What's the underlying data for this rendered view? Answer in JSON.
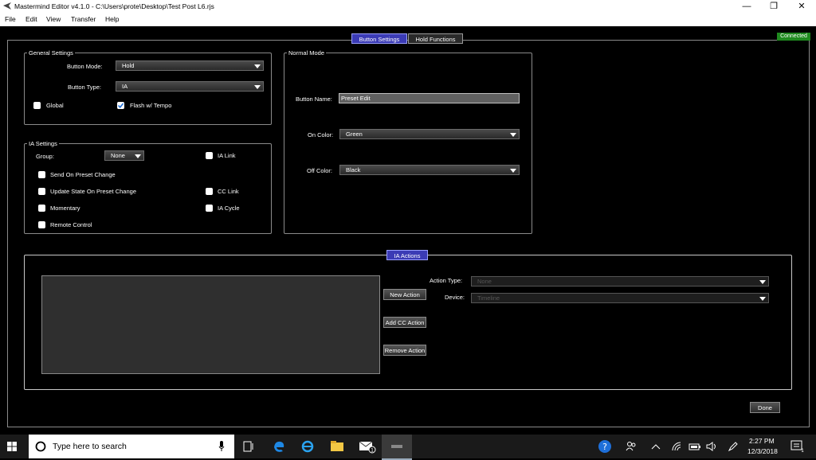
{
  "window": {
    "title": "Mastermind Editor v4.1.0 - C:\\Users\\prote\\Desktop\\Test Post L6.rjs",
    "minimize": "—",
    "maximize": "❐",
    "close": "✕"
  },
  "menu": [
    "File",
    "Edit",
    "View",
    "Transfer",
    "Help"
  ],
  "tabs": [
    "Button Settings",
    "Hold Functions"
  ],
  "status": {
    "connected": "Connected"
  },
  "general": {
    "title": "General Settings",
    "button_mode_label": "Button Mode:",
    "button_mode": "Hold",
    "button_type_label": "Button Type:",
    "button_type": "IA",
    "global_label": "Global",
    "global_checked": false,
    "flash_label": "Flash w/ Tempo",
    "flash_checked": true
  },
  "ia": {
    "title": "IA Settings",
    "group_label": "Group:",
    "group_value": "None",
    "ia_link": "IA Link",
    "send_on_preset": "Send On Preset Change",
    "update_state": "Update State On Preset Change",
    "cc_link": "CC Link",
    "momentary": "Momentary",
    "ia_cycle": "IA Cycle",
    "remote_control": "Remote Control"
  },
  "normal": {
    "title": "Normal Mode",
    "button_name_label": "Button Name:",
    "button_name": "Preset Edit",
    "on_color_label": "On Color:",
    "on_color": "Green",
    "off_color_label": "Off Color:",
    "off_color": "Black"
  },
  "actions": {
    "title": "IA Actions",
    "action_type_label": "Action Type:",
    "action_type": "None",
    "device_label": "Device:",
    "device": "Timeline",
    "new_action": "New Action",
    "add_cc_action": "Add CC Action",
    "remove_action": "Remove Action"
  },
  "done": "Done",
  "taskbar": {
    "search_placeholder": "Type here to search",
    "time": "2:27 PM",
    "date": "12/3/2018",
    "notification_count": "1"
  },
  "colors": {
    "accent": "#3b3bb5",
    "connected": "#1f8a1f",
    "background": "#000000"
  }
}
